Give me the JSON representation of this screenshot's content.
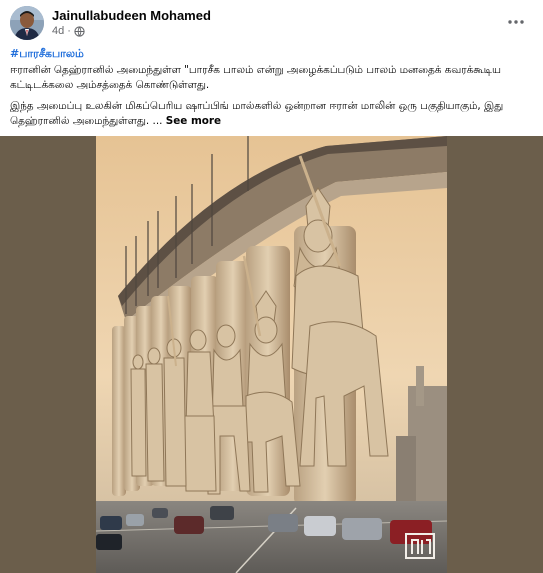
{
  "post": {
    "author": "Jainullabudeen Mohamed",
    "time": "4d",
    "privacy_icon": "globe-icon",
    "more_icon": "more-horizontal-icon",
    "hashtag": "#பாரசீகபாலம்",
    "paragraph1": " ஈரானின் தெஹ்ரானில் அமைந்துள்ள \"பாரசீக பாலம் என்று அழைக்கப்படும் பாலம் மனதைக் கவரக்கூடிய கட்டிடக்கலை அம்சத்தைக் கொண்டுள்ளது.",
    "paragraph2": "இந்த அமைப்பு உலகின் மிகப்பெரிய ஷாப்பிங் மால்களில் ஒன்றான ஈரான் மாலின் ஒரு பகுதியாகும், இது தெஹ்ரானில் அமைந்துள்ளது. ...",
    "see_more": "See more"
  },
  "colors": {
    "link": "#216fdb",
    "meta": "#65676b",
    "media_backdrop": "#6b5e4b",
    "sky": "#e9c79a",
    "statue": "#d8c3a3"
  }
}
